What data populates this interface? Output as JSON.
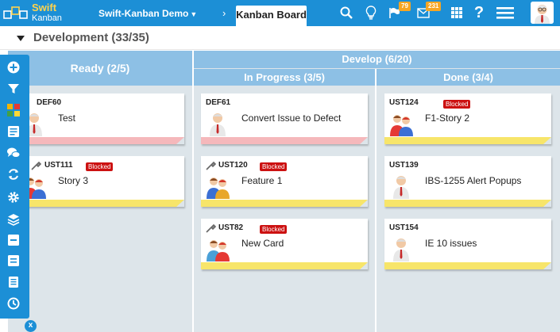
{
  "app": {
    "logo_line1": "Swift",
    "logo_line2": "Kanban",
    "project": "Swift-Kanban Demo",
    "board_tab": "Kanban Board",
    "notifications_count": "79",
    "messages_count": "231",
    "accent_color": "#1c8fd6",
    "icons": [
      "search-icon",
      "lightbulb-icon",
      "flag-icon",
      "mail-icon",
      "apps-grid-icon",
      "help-icon",
      "menu-icon",
      "avatar"
    ]
  },
  "section": {
    "title": "Development (33/35)"
  },
  "board": {
    "columns": {
      "ready": "Ready (2/5)",
      "develop": "Develop (6/20)",
      "in_progress": "In Progress (3/5)",
      "done": "Done (3/4)"
    },
    "blocked_label": "Blocked",
    "cards": {
      "def60": {
        "id": "DEF60",
        "title": "Test"
      },
      "ust111": {
        "id": "UST111",
        "title": "Story 3"
      },
      "def61": {
        "id": "DEF61",
        "title": "Convert Issue to Defect"
      },
      "ust120": {
        "id": "UST120",
        "title": "Feature 1"
      },
      "ust82": {
        "id": "UST82",
        "title": "New Card"
      },
      "ust124": {
        "id": "UST124",
        "title": "F1-Story 2"
      },
      "ust139": {
        "id": "UST139",
        "title": "IBS-1255 Alert Popups"
      },
      "ust154": {
        "id": "UST154",
        "title": "IE 10 issues"
      }
    }
  },
  "sidebar": {
    "icons": [
      "add-icon",
      "filter-icon",
      "color-legend-icon",
      "card-details-icon",
      "comments-icon",
      "refresh-icon",
      "settings-icon",
      "layers-icon",
      "collapse-icon",
      "list-icon",
      "report-icon",
      "history-icon"
    ],
    "close_label": "x"
  }
}
